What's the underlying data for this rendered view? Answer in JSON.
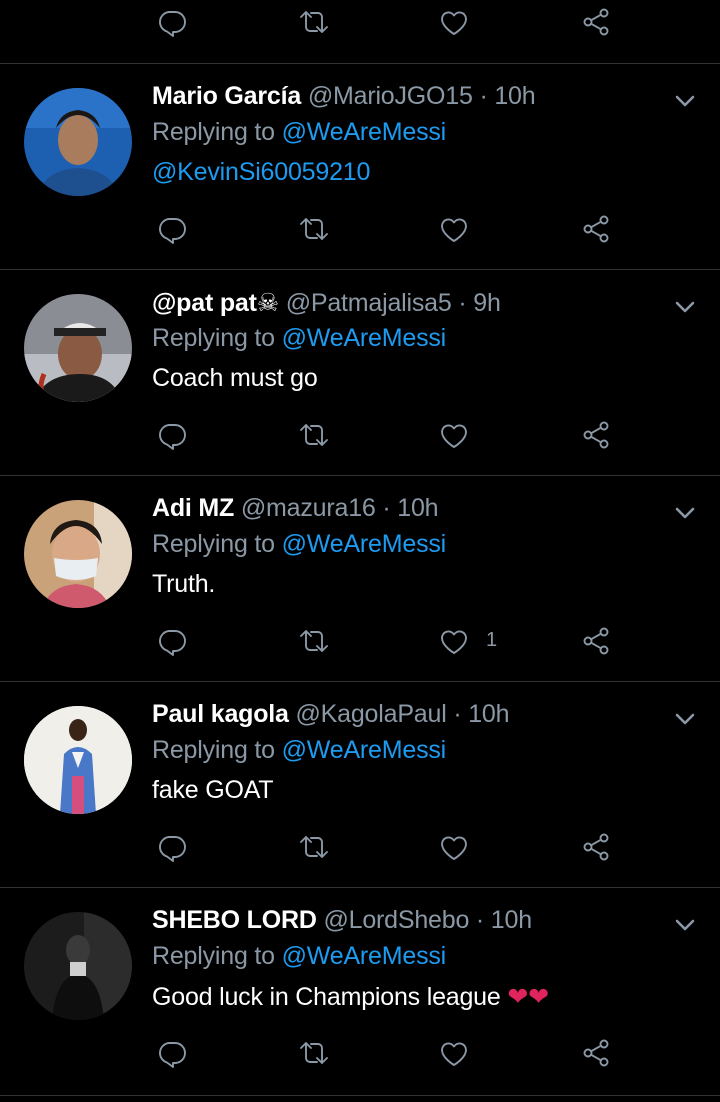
{
  "colors": {
    "background": "#000000",
    "text": "#ffffff",
    "muted": "#8b98a5",
    "link": "#1d9bf0",
    "divider": "#2f3336",
    "heart": "#e0245e"
  },
  "top_actions": {
    "icons": [
      "reply-icon",
      "retweet-icon",
      "like-icon",
      "share-icon"
    ]
  },
  "tweets": [
    {
      "name": "Mario García",
      "handle": "@MarioJGO15",
      "sep": "·",
      "time": "10h",
      "replying_prefix": "Replying to ",
      "replying_to": "@WeAreMessi",
      "body": "@KevinSi60059210",
      "body_is_link": true,
      "like_count": ""
    },
    {
      "name": "@pat pat☠",
      "handle": "@Patmajalisa5",
      "sep": "·",
      "time": "9h",
      "replying_prefix": "Replying to ",
      "replying_to": "@WeAreMessi",
      "body": "Coach must go",
      "like_count": ""
    },
    {
      "name": "Adi MZ",
      "handle": "@mazura16",
      "sep": "·",
      "time": "10h",
      "replying_prefix": "Replying to ",
      "replying_to": "@WeAreMessi",
      "body": "Truth.",
      "like_count": "1"
    },
    {
      "name": "Paul kagola",
      "handle": "@KagolaPaul",
      "sep": "·",
      "time": "10h",
      "replying_prefix": "Replying to ",
      "replying_to": "@WeAreMessi",
      "body": "fake GOAT",
      "like_count": ""
    },
    {
      "name": "SHEBO LORD",
      "handle": "@LordShebo",
      "sep": "·",
      "time": "10h",
      "replying_prefix": "Replying to ",
      "replying_to": "@WeAreMessi",
      "body": "Good luck in Champions league ",
      "body_emoji": "❤❤",
      "like_count": ""
    }
  ]
}
